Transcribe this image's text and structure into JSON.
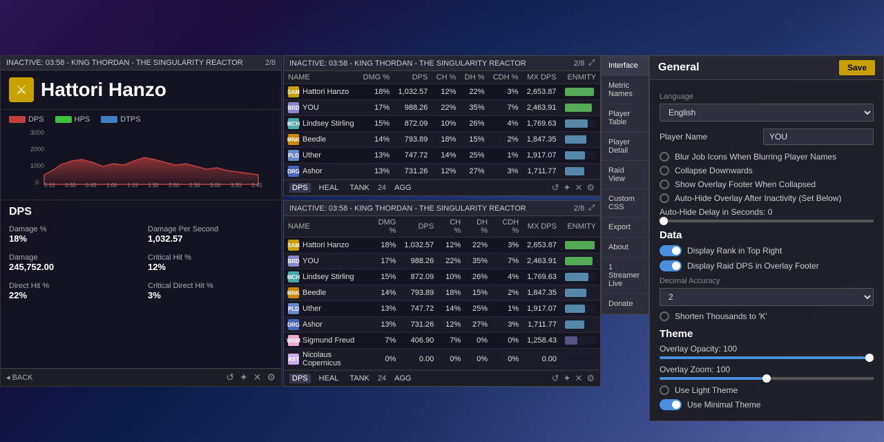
{
  "background": {
    "color1": "#2c1654",
    "color2": "#1a0a3a"
  },
  "leftPanel": {
    "header": "INACTIVE: 03:58 - KING THORDAN - THE SINGULARITY REACTOR",
    "badge": "2/8",
    "playerName": "Hattori Hanzo",
    "jobIcon": "🗡",
    "chart": {
      "legend": [
        {
          "label": "DPS",
          "color": "#c04040"
        },
        {
          "label": "HPS",
          "color": "#40c040"
        },
        {
          "label": "DTPS",
          "color": "#4080c0"
        }
      ]
    },
    "sectionTitle": "DPS",
    "stats": [
      {
        "label": "Damage %",
        "value": "18%"
      },
      {
        "label": "Damage Per Second",
        "value": "1,032.57"
      },
      {
        "label": "Damage",
        "value": "245,752.00"
      },
      {
        "label": "Critical Hit %",
        "value": "12%"
      },
      {
        "label": "Direct Hit %",
        "value": "22%"
      },
      {
        "label": "Critical Direct Hit %",
        "value": "3%"
      }
    ],
    "backBtn": "◂ BACK",
    "footerIcons": [
      "↺",
      "✦",
      "✕",
      "⚙"
    ]
  },
  "topOverlay": {
    "header": "INACTIVE: 03:58 - KING THORDAN - THE SINGULARITY REACTOR",
    "badge": "2/8",
    "columns": [
      "NAME",
      "DMG %",
      "DPS",
      "CH %",
      "DH %",
      "CDH %",
      "MX DPS",
      "ENMITY"
    ],
    "rows": [
      {
        "name": "Hattori Hanzo",
        "job": "SAM",
        "jobColor": "#c8a000",
        "dmgPct": "18%",
        "dps": "1,032.57",
        "ch": "12%",
        "dh": "22%",
        "cdh": "3%",
        "mxDps": "2,653.87",
        "barPct": 95
      },
      {
        "name": "YOU",
        "job": "BRD",
        "jobColor": "#8888cc",
        "dmgPct": "17%",
        "dps": "988.26",
        "ch": "22%",
        "dh": "35%",
        "cdh": "7%",
        "mxDps": "2,463.91",
        "barPct": 88
      },
      {
        "name": "Lindsey Stirling",
        "job": "MCH",
        "jobColor": "#44aaaa",
        "dmgPct": "15%",
        "dps": "872.09",
        "ch": "10%",
        "dh": "26%",
        "cdh": "4%",
        "mxDps": "1,769.63",
        "barPct": 75
      },
      {
        "name": "Beedle",
        "job": "MNK",
        "jobColor": "#cc8800",
        "dmgPct": "14%",
        "dps": "793.89",
        "ch": "18%",
        "dh": "15%",
        "cdh": "2%",
        "mxDps": "1,847.35",
        "barPct": 70
      },
      {
        "name": "Uther",
        "job": "PLD",
        "jobColor": "#6688cc",
        "dmgPct": "13%",
        "dps": "747.72",
        "ch": "14%",
        "dh": "25%",
        "cdh": "1%",
        "mxDps": "1,917.07",
        "barPct": 65
      },
      {
        "name": "Ashor",
        "job": "DRG",
        "jobColor": "#4466bb",
        "dmgPct": "13%",
        "dps": "731.26",
        "ch": "12%",
        "dh": "27%",
        "cdh": "3%",
        "mxDps": "1,711.77",
        "barPct": 63
      }
    ],
    "tabs": [
      {
        "label": "DPS",
        "active": true
      },
      {
        "label": "HEAL",
        "active": false
      },
      {
        "label": "TANK",
        "active": false
      },
      {
        "label": "24",
        "active": false
      },
      {
        "label": "AGG",
        "active": false
      }
    ],
    "footerIcons": [
      "↺",
      "✦",
      "✕",
      "⚙"
    ]
  },
  "bottomOverlay": {
    "header": "INACTIVE: 03:58 - KING THORDAN - THE SINGULARITY REACTOR",
    "badge": "2/8",
    "columns": [
      "NAME",
      "DMG %",
      "DPS",
      "CH %",
      "DH %",
      "CDH %",
      "MX DPS",
      "ENMITY"
    ],
    "rows": [
      {
        "name": "Hattori Hanzo",
        "job": "SAM",
        "jobColor": "#c8a000",
        "dmgPct": "18%",
        "dps": "1,032.57",
        "ch": "12%",
        "dh": "22%",
        "cdh": "3%",
        "mxDps": "2,653.87",
        "barPct": 95
      },
      {
        "name": "YOU",
        "job": "BRD",
        "jobColor": "#8888cc",
        "dmgPct": "17%",
        "dps": "988.26",
        "ch": "22%",
        "dh": "35%",
        "cdh": "7%",
        "mxDps": "2,463.91",
        "barPct": 88
      },
      {
        "name": "Lindsey Stirling",
        "job": "MCH",
        "jobColor": "#44aaaa",
        "dmgPct": "15%",
        "dps": "872.09",
        "ch": "10%",
        "dh": "26%",
        "cdh": "4%",
        "mxDps": "1,769.63",
        "barPct": 75
      },
      {
        "name": "Beedle",
        "job": "MNK",
        "jobColor": "#cc8800",
        "dmgPct": "14%",
        "dps": "793.89",
        "ch": "18%",
        "dh": "15%",
        "cdh": "2%",
        "mxDps": "1,847.35",
        "barPct": 70
      },
      {
        "name": "Uther",
        "job": "PLD",
        "jobColor": "#6688cc",
        "dmgPct": "13%",
        "dps": "747.72",
        "ch": "14%",
        "dh": "25%",
        "cdh": "1%",
        "mxDps": "1,917.07",
        "barPct": 65
      },
      {
        "name": "Ashor",
        "job": "DRG",
        "jobColor": "#4466bb",
        "dmgPct": "13%",
        "dps": "731.26",
        "ch": "12%",
        "dh": "27%",
        "cdh": "3%",
        "mxDps": "1,711.77",
        "barPct": 63
      },
      {
        "name": "Sigmund Freud",
        "job": "WHM",
        "jobColor": "#eeaacc",
        "dmgPct": "7%",
        "dps": "406.90",
        "ch": "7%",
        "dh": "0%",
        "cdh": "0%",
        "mxDps": "1,258.43",
        "barPct": 40
      },
      {
        "name": "Nicolaus Copernicus",
        "job": "AST",
        "jobColor": "#ccaaee",
        "dmgPct": "0%",
        "dps": "0.00",
        "ch": "0%",
        "dh": "0%",
        "cdh": "0%",
        "mxDps": "0.00",
        "barPct": 0
      }
    ],
    "tabs": [
      {
        "label": "DPS",
        "active": true
      },
      {
        "label": "HEAL",
        "active": false
      },
      {
        "label": "TANK",
        "active": false
      },
      {
        "label": "24",
        "active": false
      },
      {
        "label": "AGG",
        "active": false
      }
    ],
    "footerIcons": [
      "↺",
      "✦",
      "✕",
      "⚙"
    ]
  },
  "settingsNav": {
    "items": [
      {
        "label": "Interface",
        "active": true
      },
      {
        "label": "Metric Names",
        "active": false
      },
      {
        "label": "Player Table",
        "active": false
      },
      {
        "label": "Player Detail",
        "active": false
      },
      {
        "label": "Raid View",
        "active": false
      },
      {
        "label": "Custom CSS",
        "active": false
      },
      {
        "label": "Export",
        "active": false
      },
      {
        "label": "About",
        "active": false
      },
      {
        "label": "1 Streamer Live",
        "active": false
      },
      {
        "label": "Donate",
        "active": false
      }
    ]
  },
  "settings": {
    "title": "General",
    "saveLabel": "Save",
    "language": {
      "label": "Language",
      "value": "English"
    },
    "playerTable": {
      "label": "Player Table"
    },
    "playerNameLabel": "Player Name",
    "playerNameValue": "YOU",
    "options": [
      {
        "label": "Blur Job Icons When Blurring Player Names",
        "checked": false
      },
      {
        "label": "Collapse Downwards",
        "checked": false
      },
      {
        "label": "Show Overlay Footer When Collapsed",
        "checked": false
      },
      {
        "label": "Auto-Hide Overlay After Inactivity (Set Below)",
        "checked": false
      }
    ],
    "autoHideLabel": "Auto-Hide Delay in Seconds: 0",
    "dataTitle": "Data",
    "dataOptions": [
      {
        "label": "Display Rank in Top Right",
        "toggle": true
      },
      {
        "label": "Display Raid DPS in Overlay Footer",
        "toggle": true
      }
    ],
    "decimalAccuracyLabel": "Decimal Accuracy",
    "decimalAccuracyValue": "2",
    "shortenLabel": "Shorten Thousands to 'K'",
    "shortenChecked": false,
    "themeTitle": "Theme",
    "overlayOpacityLabel": "Overlay Opacity: 100",
    "overlayOpacityValue": 100,
    "overlayZoomLabel": "Overlay Zoom: 100",
    "overlayZoomValue": 100,
    "themeOptions": [
      {
        "label": "Use Light Theme",
        "checked": false
      },
      {
        "label": "Use Minimal Theme",
        "toggle": true
      }
    ]
  }
}
